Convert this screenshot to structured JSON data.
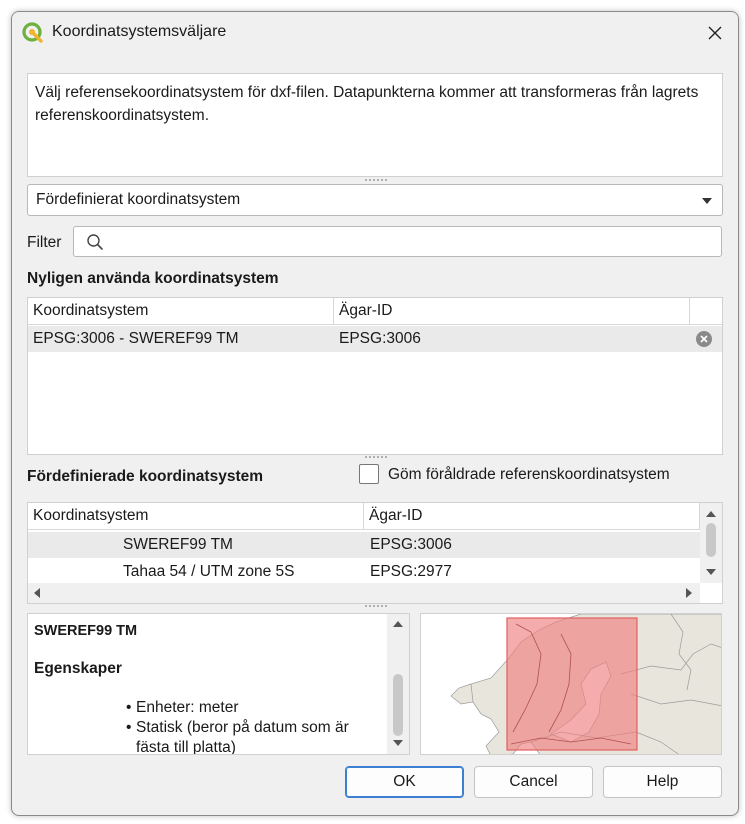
{
  "window": {
    "title": "Koordinatsystemsväljare"
  },
  "description": "Välj referensekoordinatsystem för dxf-filen. Datapunkterna kommer att transformeras från lagrets referenskoordinatsystem.",
  "crs_type_combo": {
    "selected": "Fördefinierat koordinatsystem"
  },
  "filter": {
    "label": "Filter",
    "value": ""
  },
  "recent": {
    "heading": "Nyligen använda koordinatsystem",
    "columns": [
      "Koordinatsystem",
      "Ägar-ID"
    ],
    "rows": [
      {
        "name": "EPSG:3006 - SWEREF99 TM",
        "id": "EPSG:3006"
      }
    ]
  },
  "predefined": {
    "heading": "Fördefinierade koordinatsystem",
    "hide_deprecated_label": "Göm föråldrade referenskoordinatsystem",
    "hide_deprecated_checked": false,
    "columns": [
      "Koordinatsystem",
      "Ägar-ID"
    ],
    "rows": [
      {
        "name": "SWEREF99 TM",
        "id": "EPSG:3006"
      },
      {
        "name": "Tahaa 54 / UTM zone 5S",
        "id": "EPSG:2977"
      }
    ]
  },
  "properties": {
    "crs_name": "SWEREF99 TM",
    "section": "Egenskaper",
    "items": [
      "Enheter: meter",
      "Statisk (beror på datum som är fästa till platta)"
    ]
  },
  "buttons": {
    "ok": "OK",
    "cancel": "Cancel",
    "help": "Help"
  },
  "colors": {
    "accent": "#3d7fd1",
    "selected_row": "#eaeaea",
    "extent_fill": "#f08080",
    "land": "#e8e6dc",
    "water": "#ffffff"
  }
}
